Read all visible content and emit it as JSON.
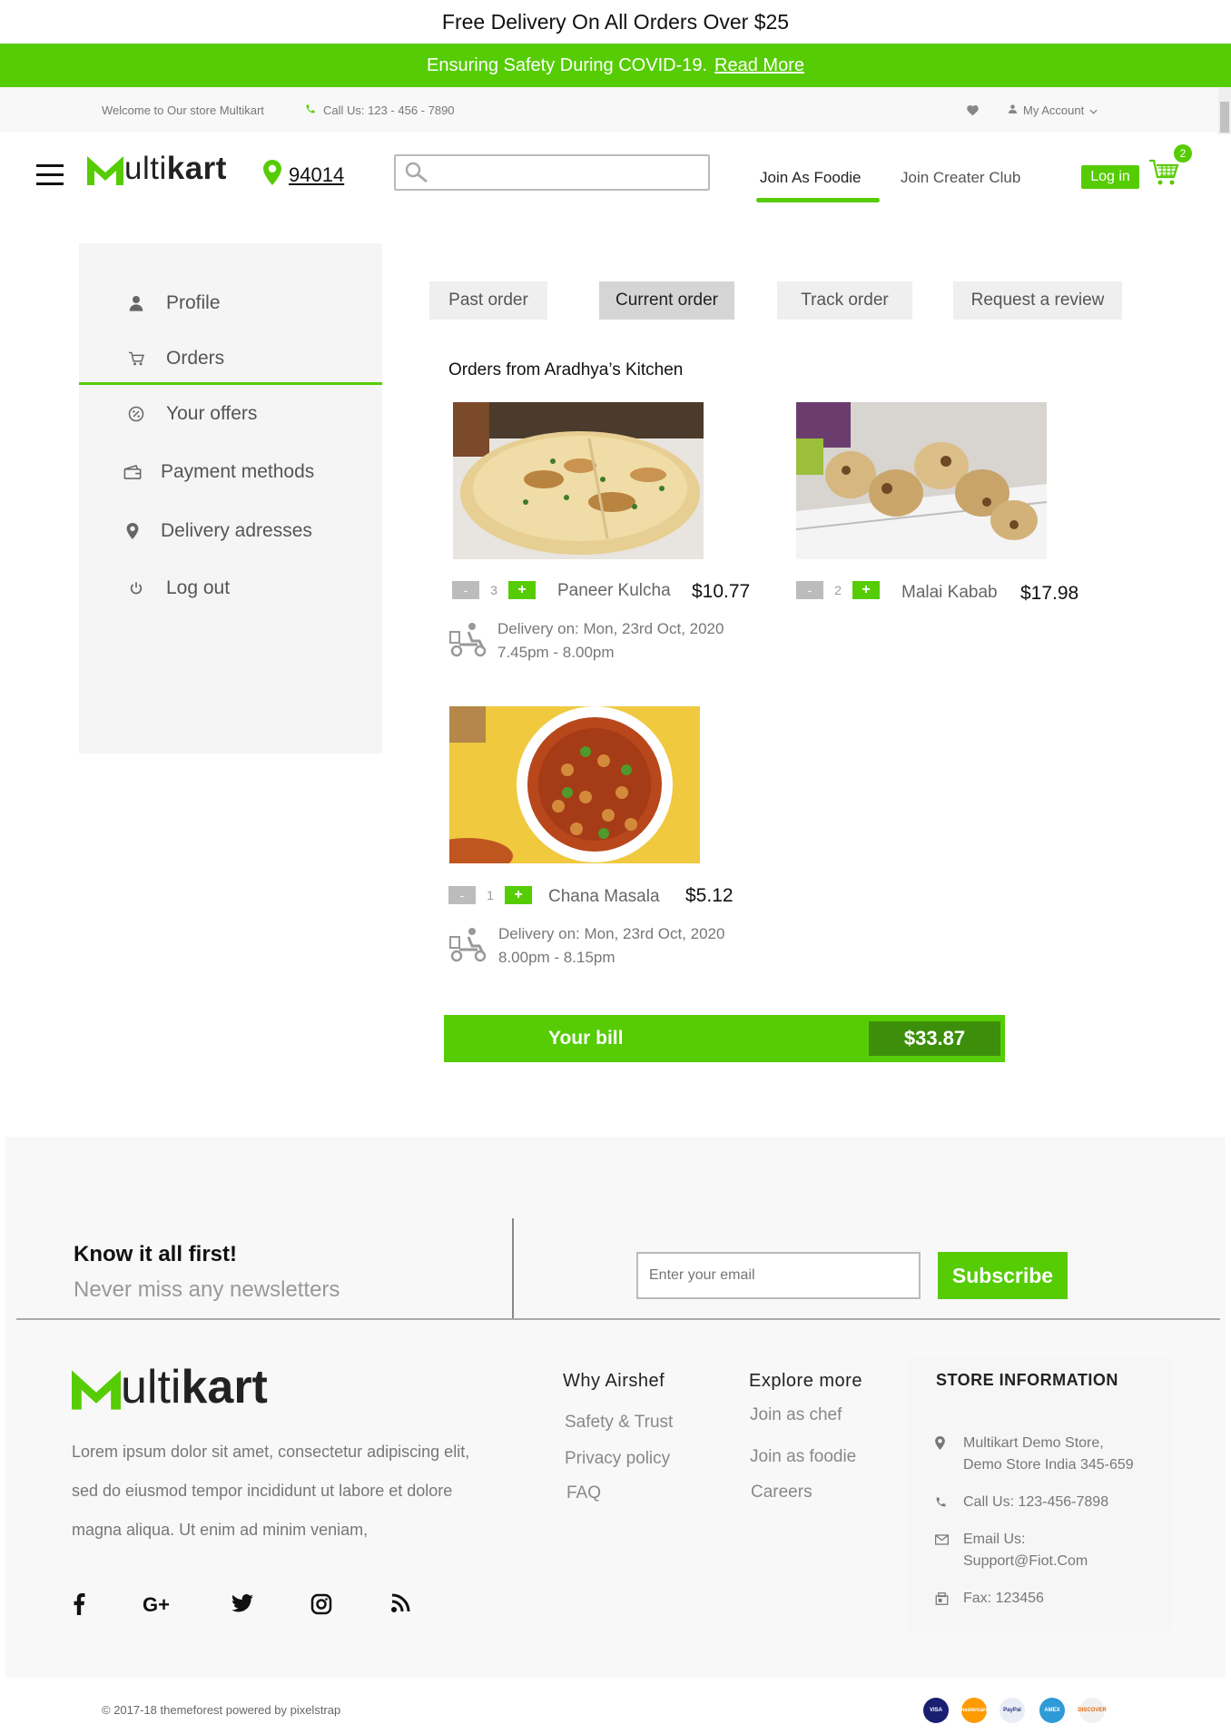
{
  "banners": {
    "top": "Free Delivery On All Orders Over $25",
    "covid_text": "Ensuring Safety During COVID-19.",
    "covid_link": "Read More"
  },
  "utility_bar": {
    "welcome": "Welcome to Our store Multikart",
    "phone": "Call Us: 123 - 456 - 7890",
    "account": "My Account"
  },
  "header": {
    "logo_first": "M",
    "logo_light": "ulti",
    "logo_bold": "kart",
    "zip": "94014",
    "search_placeholder": "",
    "nav_foodie": "Join As Foodie",
    "nav_club": "Join Creater Club",
    "login": "Log in",
    "cart_count": "2"
  },
  "sidebar": {
    "items": [
      {
        "label": "Profile",
        "icon": "user-icon"
      },
      {
        "label": "Orders",
        "icon": "cart-icon"
      },
      {
        "label": "Your offers",
        "icon": "percent-badge-icon"
      },
      {
        "label": "Payment methods",
        "icon": "wallet-icon"
      },
      {
        "label": "Delivery adresses",
        "icon": "location-pin-icon"
      },
      {
        "label": "Log out",
        "icon": "power-icon"
      }
    ]
  },
  "tabs": [
    {
      "label": "Past order",
      "active": false
    },
    {
      "label": "Current order",
      "active": true
    },
    {
      "label": "Track order",
      "active": false
    },
    {
      "label": "Request a review",
      "active": false
    }
  ],
  "orders": {
    "kitchen_title": "Orders from Aradhya’s Kitchen",
    "items": [
      {
        "name": "Paneer Kulcha",
        "price": "$10.77",
        "qty": "3",
        "minus": "-",
        "plus": "+",
        "delivery_line1": "Delivery on: Mon, 23rd Oct, 2020",
        "delivery_line2": "7.45pm - 8.00pm"
      },
      {
        "name": "Malai Kabab",
        "price": "$17.98",
        "qty": "2",
        "minus": "-",
        "plus": "+"
      },
      {
        "name": "Chana Masala",
        "price": "$5.12",
        "qty": "1",
        "minus": "-",
        "plus": "+",
        "delivery_line1": "Delivery on: Mon, 23rd Oct, 2020",
        "delivery_line2": "8.00pm - 8.15pm"
      }
    ],
    "bill_label": "Your bill",
    "bill_amount": "$33.87"
  },
  "newsletter": {
    "title": "Know it all first!",
    "subtitle": "Never miss any newsletters",
    "email_placeholder": "Enter your email",
    "button": "Subscribe"
  },
  "footer": {
    "description": "Lorem ipsum dolor sit amet, consectetur adipiscing elit, sed do eiusmod tempor incididunt ut labore et dolore magna aliqua. Ut enim ad minim veniam,",
    "why_title": "Why Airshef",
    "why_links": [
      "Safety & Trust",
      "Privacy policy",
      "FAQ"
    ],
    "explore_title": "Explore more",
    "explore_links": [
      "Join as chef",
      "Join as foodie",
      "Careers"
    ],
    "store_title": "STORE INFORMATION",
    "store_address_1": "Multikart Demo Store,",
    "store_address_2": "Demo Store India 345-659",
    "store_phone": "Call Us: 123-456-7898",
    "store_email_label": "Email Us:",
    "store_email": "Support@Fiot.Com",
    "store_fax": "Fax: 123456",
    "copyright": "© 2017-18 themeforest powered by pixelstrap",
    "payment_labels": [
      "VISA",
      "mastercard",
      "PayPal",
      "AMEX",
      "DISCOVER"
    ]
  },
  "colors": {
    "accent": "#56cc04",
    "bill_dark": "#3d8f0b",
    "sidebar_bg": "#f5f5f5",
    "footer_bg": "#f8f8f8"
  }
}
